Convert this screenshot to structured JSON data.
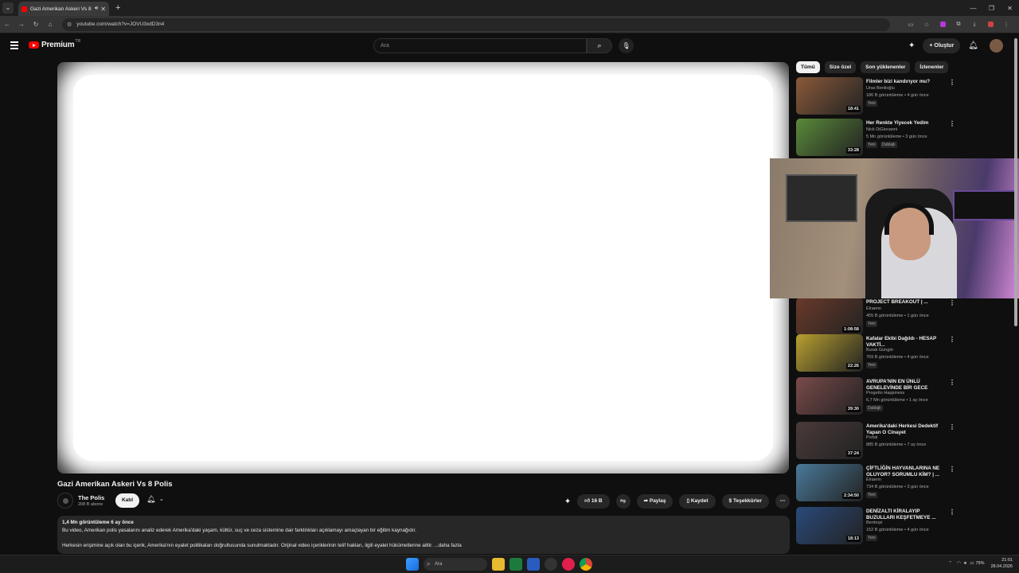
{
  "browser": {
    "tab_title": "Gazi Amerikan Askeri Vs 8",
    "url": "youtube.com/watch?v=JOVU3xdD3n4"
  },
  "header": {
    "logo": "Premium",
    "logo_sup": "TR",
    "search_placeholder": "Ara",
    "create_label": "Oluştur"
  },
  "video": {
    "title": "Gazi Amerikan Askeri Vs 8 Polis",
    "channel": "The Polis",
    "subs": "208 B abone",
    "join": "Katıl",
    "likes": "16 B",
    "share": "Paylaş",
    "save": "Kaydet",
    "thanks": "Teşekkürler"
  },
  "description": {
    "meta": "1,4 Mn görüntüleme  6 ay önce",
    "line1": "Bu video, Amerikan polis yasalarını analiz ederek Amerika'daki yaşam, kültür, suç ve ceza sistemine dair farklılıkları açıklamayı amaçlayan bir eğitim kaynağıdır.",
    "line2": "Herkesin erişimine açık olan bu içerik, Amerika'nın eyalet politikaları doğrultusunda sunulmaktadır. Orijinal video içeriklerinin telif hakları, ilgili eyalet hükümetlerine aittir.  ...daha fazla"
  },
  "chips": [
    "Tümü",
    "Size özel",
    "Son yüklenenler",
    "İzlenenler"
  ],
  "recs": [
    {
      "title": "Filmler bizi kandırıyor mu?",
      "channel": "Uras Benlioğlu",
      "meta": "186 B görüntüleme • 4 gün önce",
      "dur": "18:41",
      "badge": "Yeni",
      "color": "#8a5a3a"
    },
    {
      "title": "Her Renkte Yiyecek Yedim",
      "channel": "Nick DiGiovanni",
      "meta": "5 Mn görüntüleme • 3 gün önce",
      "dur": "33:28",
      "badge": "Yeni",
      "badge2": "Dublajlı",
      "color": "#5a8a3a"
    },
    {
      "title": "PROJECT BREAKOUT | ...",
      "channel": "Elraenn",
      "meta": "455 B görüntüleme • 1 gün önce",
      "dur": "1:08:58",
      "badge": "Yeni",
      "color": "#6a3a2a"
    },
    {
      "title": "Kafalar Ekibi Dağıldı - HESAP VAKTİ...",
      "channel": "Burak Güngör",
      "meta": "769 B görüntüleme • 4 gün önce",
      "dur": "22:26",
      "badge": "Yeni",
      "color": "#b8a030"
    },
    {
      "title": "AVRUPA'NIN EN ÜNLÜ GENELEVİNDE BİR GECE",
      "channel": "Progetto Happiness",
      "meta": "6,7 Mn görüntüleme • 1 ay önce",
      "dur": "39:30",
      "badge": "Dublajlı",
      "color": "#7a4a4a"
    },
    {
      "title": "Amerika'daki Herkesi Dedektif Yapan O Cinayet",
      "channel": "Portal",
      "meta": "885 B görüntüleme • 7 ay önce",
      "dur": "37:24",
      "badge": "",
      "color": "#4a3a3a"
    },
    {
      "title": "ÇİFTLİĞİN HAYVANLARINA NE OLUYOR? SORUMLU KİM? | ...",
      "channel": "Elraenn",
      "meta": "734 B görüntüleme • 3 gün önce",
      "dur": "2:34:50",
      "badge": "Yeni",
      "color": "#4a7a9a"
    },
    {
      "title": "DENİZALTI KİRALAYIP BUZULLARI KEŞFETMEYE ...",
      "channel": "Bentropi",
      "meta": "152 B görüntüleme • 4 gün önce",
      "dur": "18:13",
      "badge": "Yeni",
      "color": "#2a4a7a"
    }
  ],
  "taskbar": {
    "search": "Ara",
    "battery": "79%",
    "time": "21:01",
    "date": "28.04.2026"
  }
}
